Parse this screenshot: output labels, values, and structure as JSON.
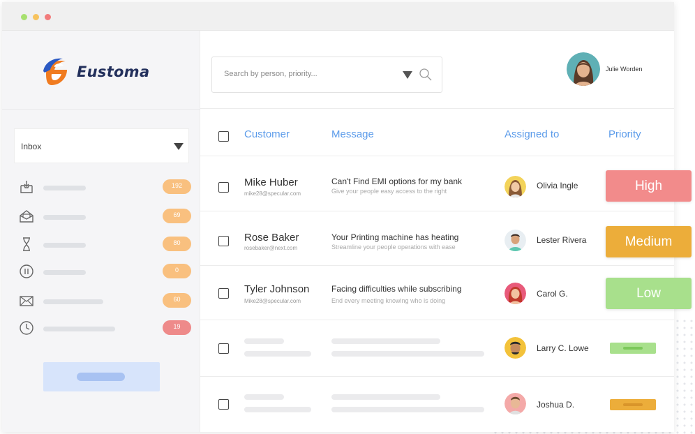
{
  "colors": {
    "accent": "#5b9bea",
    "high": "#f28b8b",
    "medium": "#ecad3a",
    "low": "#a8e08c",
    "badge_orange": "#f9c07f",
    "badge_red": "#ee8a8a"
  },
  "window": {
    "traffic_lights": [
      "#a7e06f",
      "#f7c35e",
      "#f27c7c"
    ]
  },
  "brand": {
    "name": "Eustoma",
    "logo_icon": "eustoma-e-logo"
  },
  "sidebar": {
    "inbox_label": "Inbox",
    "items": [
      {
        "icon": "inbox-download-icon",
        "count": "192",
        "badge_color": "#f9c07f"
      },
      {
        "icon": "open-envelope-icon",
        "count": "69",
        "badge_color": "#f9c07f"
      },
      {
        "icon": "hourglass-icon",
        "count": "80",
        "badge_color": "#f9c07f"
      },
      {
        "icon": "pause-circle-icon",
        "count": "0",
        "badge_color": "#f9c07f"
      },
      {
        "icon": "envelope-icon",
        "count": "60",
        "badge_color": "#f9c07f"
      },
      {
        "icon": "clock-icon",
        "count": "19",
        "badge_color": "#ee8a8a"
      }
    ]
  },
  "search": {
    "placeholder": "Search by person, priority..."
  },
  "user": {
    "name": "Julie Worden"
  },
  "table": {
    "headers": {
      "customer": "Customer",
      "message": "Message",
      "assigned": "Assigned to",
      "priority": "Priority"
    },
    "rows": [
      {
        "name": "Mike Huber",
        "email": "mike28@specular.com",
        "message": "Can't Find EMI options for my bank",
        "message_sub": "Give your people easy access to the right",
        "assignee": "Olivia Ingle",
        "priority": "High",
        "priority_color": "#f28b8b"
      },
      {
        "name": "Rose Baker",
        "email": "rosebaker@next.com",
        "message": "Your Printing machine has heating",
        "message_sub": "Streamline your people operations with ease",
        "assignee": "Lester Rivera",
        "priority": "Medium",
        "priority_color": "#ecad3a"
      },
      {
        "name": "Tyler Johnson",
        "email": "Mike28@specular.com",
        "message": "Facing difficulties while subscribing",
        "message_sub": "End every meeting knowing who is doing",
        "assignee": "Carol G.",
        "priority": "Low",
        "priority_color": "#a8e08c"
      },
      {
        "assignee": "Larry C. Lowe",
        "priority_color": "#a8e08c"
      },
      {
        "assignee": "Joshua D.",
        "priority_color": "#ecad3a"
      }
    ]
  }
}
